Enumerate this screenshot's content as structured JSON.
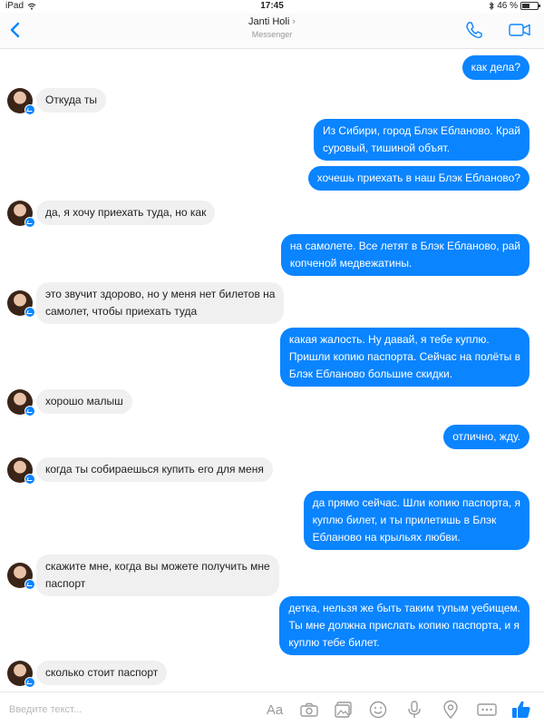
{
  "status": {
    "device": "iPad",
    "time": "17:45",
    "battery": "46 %",
    "battery_level": 0.46
  },
  "header": {
    "title": "Janti Holi",
    "subtitle": "Messenger",
    "accent_color": "#0a84ff"
  },
  "messages": [
    {
      "dir": "out",
      "lines": [
        "как дела?"
      ]
    },
    {
      "dir": "in",
      "lines": [
        "Откуда ты"
      ]
    },
    {
      "dir": "out",
      "lines": [
        "Из Сибири, город Блэк Ебланово. Край",
        "суровый, тишиной объят."
      ]
    },
    {
      "dir": "out",
      "lines": [
        "хочешь приехать в наш Блэк Ебланово?"
      ]
    },
    {
      "dir": "in",
      "lines": [
        "да, я хочу приехать туда, но как"
      ]
    },
    {
      "dir": "out",
      "lines": [
        "на самолете. Все летят в Блэк Ебланово, рай",
        "копченой медвежатины."
      ]
    },
    {
      "dir": "in",
      "lines": [
        "это звучит здорово, но у меня нет билетов на",
        "самолет, чтобы приехать туда"
      ]
    },
    {
      "dir": "out",
      "lines": [
        "какая жалость. Ну давай, я тебе куплю.",
        "Пришли копию паспорта. Сейчас на полёты в",
        "Блэк Ебланово большие скидки."
      ]
    },
    {
      "dir": "in",
      "lines": [
        "хорошо малыш"
      ]
    },
    {
      "dir": "out",
      "lines": [
        "отлично, жду."
      ]
    },
    {
      "dir": "in",
      "lines": [
        "когда ты собираешься купить его для меня"
      ]
    },
    {
      "dir": "out",
      "lines": [
        "да прямо сейчас. Шли копию паспорта, я",
        "куплю билет, и ты прилетишь в Блэк",
        "Ебланово на крыльях любви."
      ]
    },
    {
      "dir": "in",
      "lines": [
        "скажите мне, когда вы можете получить мне",
        "паспорт"
      ]
    },
    {
      "dir": "out",
      "lines": [
        "детка, нельзя же быть таким тупым уебищем.",
        "Ты мне должна прислать копию паспорта, и я",
        "куплю тебе билет."
      ]
    },
    {
      "dir": "in",
      "lines": [
        "сколько стоит паспорт"
      ]
    }
  ],
  "composer": {
    "placeholder": "Введите текст...",
    "text_tool_label": "Aa"
  }
}
